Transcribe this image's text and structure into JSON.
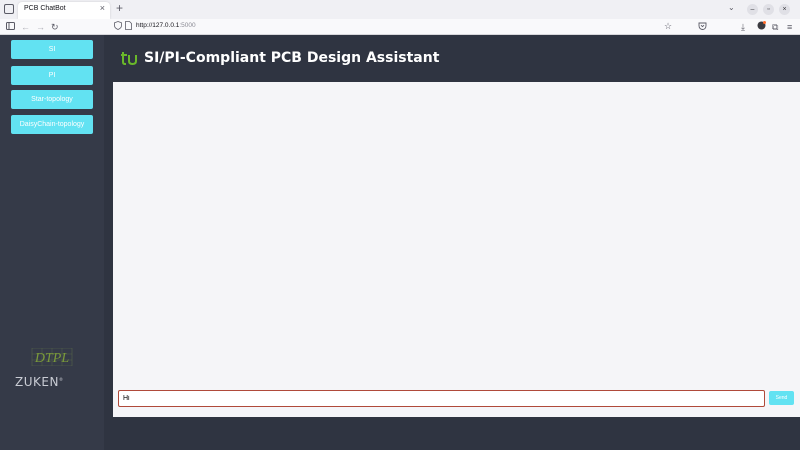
{
  "browser": {
    "tab_title": "PCB ChatBot",
    "tab_close": "×",
    "new_tab": "+",
    "tab_list": "⌄",
    "url_host": "http://127.0.0.1",
    "url_rest": ":5000",
    "window_minimize": "–",
    "window_maximize": "▫",
    "window_close": "×"
  },
  "sidebar": {
    "items": [
      {
        "label": "SI"
      },
      {
        "label": "PI"
      },
      {
        "label": "Star-topology"
      },
      {
        "label": "DaisyChain-topology"
      }
    ],
    "logo_top": "DTPL",
    "logo_bottom": "ZUKEN",
    "logo_bottom_mark": "®"
  },
  "header": {
    "logo_text": "tu",
    "title": "SI/PI-Compliant PCB Design Assistant"
  },
  "chat": {
    "input_value": "Hi",
    "send_label": "Send"
  },
  "colors": {
    "sidebar_bg": "#353a48",
    "main_bg": "#2f3441",
    "accent_cyan": "#62e2f2",
    "logo_green": "#6ab82a"
  }
}
